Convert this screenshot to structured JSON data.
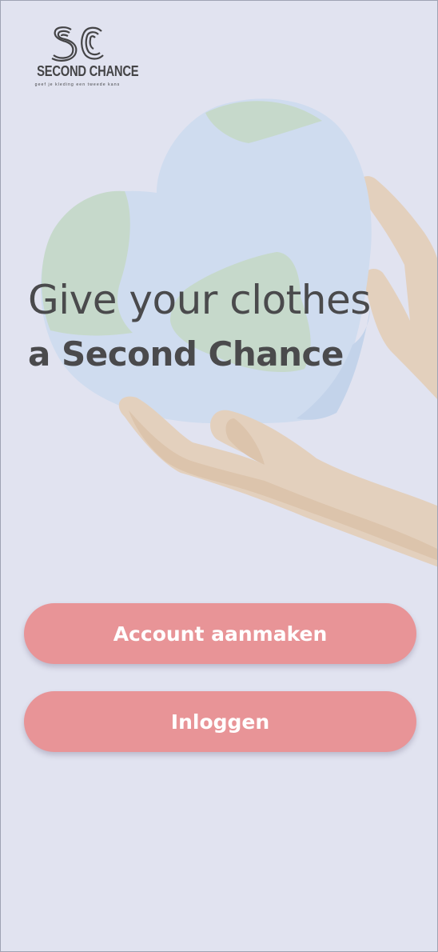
{
  "brand": {
    "logo_letters": "SC",
    "name": "SECOND CHANCE",
    "tagline": "geef je kleding een tweede kans"
  },
  "hero": {
    "line1": "Give your clothes",
    "line2": "a Second Chance"
  },
  "buttons": {
    "create_account": "Account aanmaken",
    "login": "Inloggen"
  },
  "colors": {
    "background": "#e1e3f0",
    "button": "#e89497",
    "button_text": "#ffffff",
    "heading_text": "#4a4a4c",
    "globe_water": "#cfdcef",
    "globe_land": "#c6d9cb",
    "hand_skin": "#e3d0bd"
  },
  "illustration": {
    "icon": "hands-holding-heart-globe-icon"
  }
}
